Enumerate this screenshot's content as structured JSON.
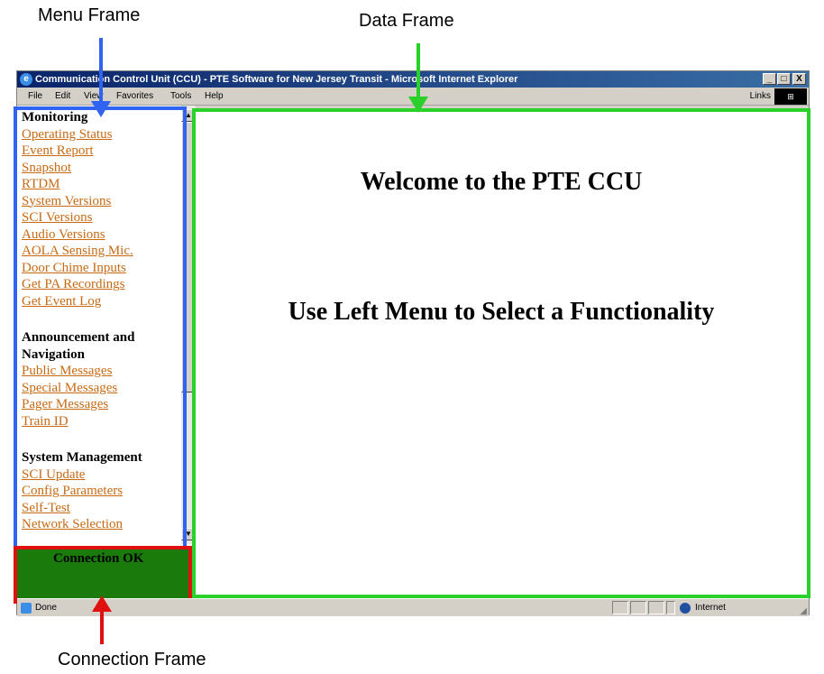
{
  "annotations": {
    "menu_frame": "Menu Frame",
    "data_frame": "Data Frame",
    "connection_frame": "Connection Frame",
    "colors": {
      "menu": "#2f63f0",
      "data": "#2bd12b",
      "connection": "#e11010"
    }
  },
  "window": {
    "title": "Communication Control Unit (CCU) - PTE Software for New Jersey Transit - Microsoft Internet Explorer",
    "min_btn": "_",
    "max_btn": "□",
    "close_btn": "X"
  },
  "menubar": {
    "file": "File",
    "edit": "Edit",
    "view": "View",
    "favorites": "Favorites",
    "tools": "Tools",
    "help": "Help",
    "links": "Links",
    "links_chevron": "»"
  },
  "left_menu": {
    "monitoring": {
      "heading": "Monitoring",
      "items": [
        "Operating Status",
        "Event Report",
        "Snapshot",
        "RTDM",
        "System Versions",
        "SCI Versions",
        "Audio Versions",
        "AOLA Sensing Mic.",
        "Door Chime Inputs",
        "Get PA Recordings",
        "Get Event Log"
      ]
    },
    "announcement": {
      "heading": "Announcement and Navigation",
      "items": [
        "Public Messages",
        "Special Messages",
        "Pager Messages",
        "Train ID"
      ]
    },
    "system": {
      "heading": "System Management",
      "items": [
        "SCI Update",
        "Config Parameters",
        "Self-Test",
        "Network Selection"
      ]
    },
    "link_color": "#c86a14"
  },
  "connection": {
    "status": "Connection OK",
    "bg_color": "#1a7a0c"
  },
  "data_frame": {
    "welcome": "Welcome to the PTE CCU",
    "instruction": "Use Left Menu to Select a Functionality"
  },
  "statusbar": {
    "status": "Done",
    "zone": "Internet"
  }
}
